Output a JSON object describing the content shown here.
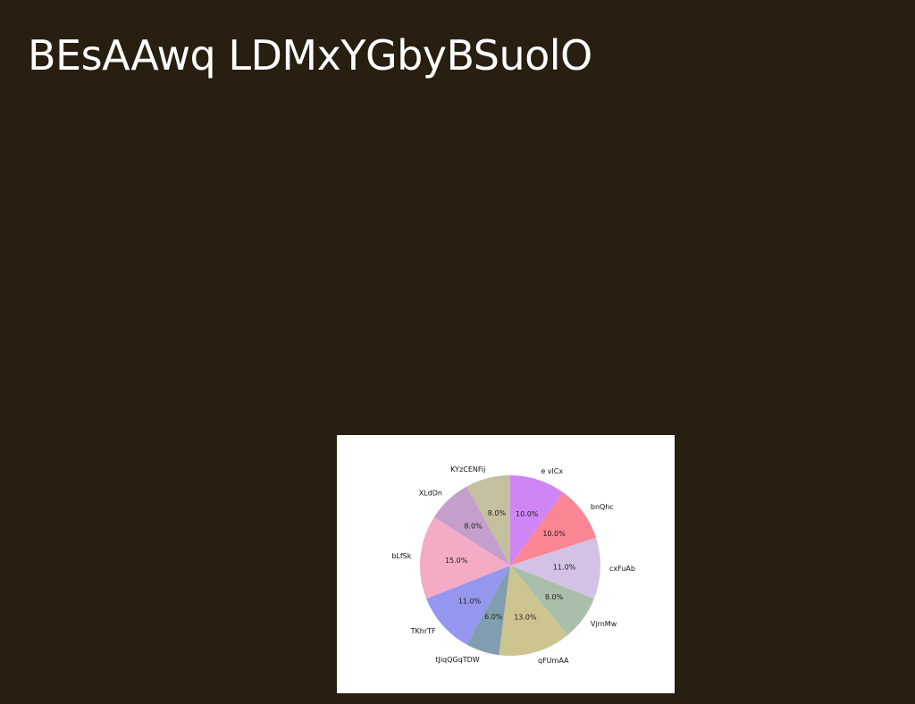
{
  "slide": {
    "title": "BEsAAwq LDMxYGbyBSuolO"
  },
  "chart_data": {
    "type": "pie",
    "title": "",
    "start_angle_deg": 90,
    "direction": "clockwise",
    "slices": [
      {
        "label": "e vlCx",
        "value": 10.0,
        "pct_label": "10.0%",
        "color": "#d085f5"
      },
      {
        "label": "bnQhc",
        "value": 10.0,
        "pct_label": "10.0%",
        "color": "#fc8593"
      },
      {
        "label": "cxFuAb",
        "value": 11.0,
        "pct_label": "11.0%",
        "color": "#d4c2e6"
      },
      {
        "label": "VjrnMw",
        "value": 8.0,
        "pct_label": "8.0%",
        "color": "#a9bfaa"
      },
      {
        "label": "qFUmAA",
        "value": 13.0,
        "pct_label": "13.0%",
        "color": "#cdc590"
      },
      {
        "label": "tJiqQGqTDW",
        "value": 6.0,
        "pct_label": "6.0%",
        "color": "#809eb0"
      },
      {
        "label": "TKhrTF",
        "value": 11.0,
        "pct_label": "11.0%",
        "color": "#9596ee"
      },
      {
        "label": "bLfSk",
        "value": 15.0,
        "pct_label": "15.0%",
        "color": "#f3abc6"
      },
      {
        "label": "XLdDn",
        "value": 8.0,
        "pct_label": "8.0%",
        "color": "#c49fcc"
      },
      {
        "label": "KYzCENFij",
        "value": 8.0,
        "pct_label": "8.0%",
        "color": "#c4bf9f"
      }
    ]
  }
}
